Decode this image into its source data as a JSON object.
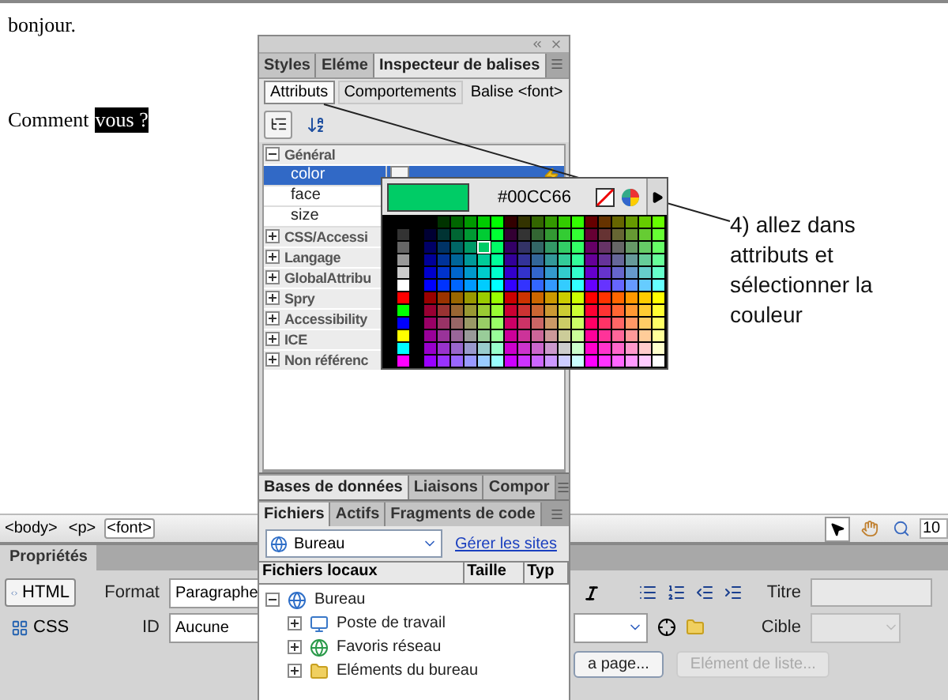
{
  "document": {
    "paragraphs": [
      {
        "text": "bonjour."
      },
      {
        "text": "Comment",
        "selected_text": "vous ?"
      }
    ]
  },
  "annotation": "4) allez dans attributs et sélectionner la couleur",
  "tag_selector": [
    {
      "label": "<body>",
      "selected": false
    },
    {
      "label": "<p>",
      "selected": false
    },
    {
      "label": "<font>",
      "selected": true
    }
  ],
  "zoom_value": "10",
  "inspector": {
    "tabs": [
      {
        "label": "Styles",
        "selected": false
      },
      {
        "label": "Eléme",
        "selected": false
      },
      {
        "label": "Inspecteur de balises",
        "selected": true
      }
    ],
    "subtabs": [
      {
        "label": "Attributs",
        "selected": true
      },
      {
        "label": "Comportements",
        "selected": false
      }
    ],
    "tag_label": "Balise <font>",
    "groups": [
      {
        "label": "Général",
        "expanded": true,
        "children": [
          {
            "label": "color",
            "selected": true
          },
          {
            "label": "face",
            "selected": false
          },
          {
            "label": "size",
            "selected": false
          }
        ]
      },
      {
        "label": "CSS/Accessi",
        "expanded": false
      },
      {
        "label": "Langage",
        "expanded": false
      },
      {
        "label": "GlobalAttribu",
        "expanded": false
      },
      {
        "label": "Spry",
        "expanded": false
      },
      {
        "label": "Accessibility",
        "expanded": false
      },
      {
        "label": "ICE",
        "expanded": false
      },
      {
        "label": "Non référenc",
        "expanded": false
      }
    ]
  },
  "color_picker": {
    "value": "#00CC66"
  },
  "panel_groups": [
    {
      "tabs": [
        {
          "label": "Bases de données",
          "selected": true
        },
        {
          "label": "Liaisons",
          "selected": false
        },
        {
          "label": "Compor",
          "selected": false
        }
      ]
    },
    {
      "tabs": [
        {
          "label": "Fichiers",
          "selected": true
        },
        {
          "label": "Actifs",
          "selected": false
        },
        {
          "label": "Fragments de code",
          "selected": false
        }
      ]
    }
  ],
  "files": {
    "site": "Bureau",
    "manage_link": "Gérer les sites",
    "columns": [
      "Fichiers locaux",
      "Taille",
      "Typ"
    ],
    "tree": [
      {
        "label": "Bureau",
        "kind": "desktop",
        "expanded": true,
        "children": [
          {
            "label": "Poste de travail",
            "kind": "computer",
            "expanded": false
          },
          {
            "label": "Favoris réseau",
            "kind": "network",
            "expanded": false
          },
          {
            "label": "Eléments du bureau",
            "kind": "folder",
            "expanded": false
          }
        ]
      }
    ]
  },
  "properties": {
    "title": "Propriétés",
    "modes": [
      {
        "label": "HTML",
        "kind": "html",
        "selected": true
      },
      {
        "label": "CSS",
        "kind": "css",
        "selected": false
      }
    ],
    "format_label": "Format",
    "format_value": "Paragraphe",
    "id_label": "ID",
    "id_value": "Aucune",
    "title_label": "Titre",
    "target_label": "Cible",
    "buttons": [
      {
        "label": "a page...",
        "disabled": false
      },
      {
        "label": "Elément de liste...",
        "disabled": true
      }
    ]
  }
}
